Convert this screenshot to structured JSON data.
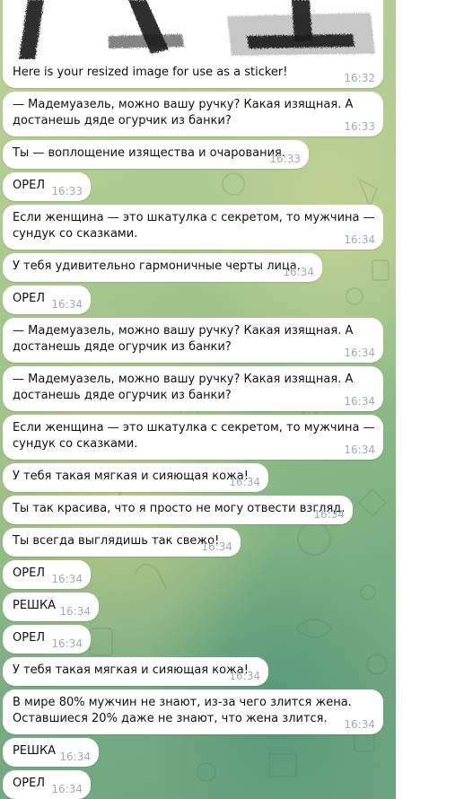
{
  "chat": {
    "sticker_caption": "Here is your resized image for use as a sticker!",
    "sticker_time": "16:32",
    "messages": [
      {
        "text": "— Мадемуазель, можно вашу ручку? Какая изящная. А\nдостанешь дяде огурчик из банки?",
        "time": "16:33"
      },
      {
        "text": "Ты — воплощение изящества и очарования.",
        "time": "16:33"
      },
      {
        "text": "ОРЕЛ",
        "time": "16:33"
      },
      {
        "text": "Если женщина — это шкатулка с секретом, то мужчина —\nсундук со сказками.",
        "time": "16:34"
      },
      {
        "text": "У тебя удивительно гармоничные черты лица.",
        "time": "16:34"
      },
      {
        "text": "ОРЕЛ",
        "time": "16:34"
      },
      {
        "text": "— Мадемуазель, можно вашу ручку? Какая изящная. А\nдостанешь дяде огурчик из банки?",
        "time": "16:34"
      },
      {
        "text": "— Мадемуазель, можно вашу ручку? Какая изящная. А\nдостанешь дяде огурчик из банки?",
        "time": "16:34"
      },
      {
        "text": "Если женщина — это шкатулка с секретом, то мужчина —\nсундук со сказками.",
        "time": "16:34"
      },
      {
        "text": "У тебя такая мягкая и сияющая кожа!",
        "time": "16:34"
      },
      {
        "text": "Ты так красива, что я просто не могу отвести взгляд.",
        "time": "16:34"
      },
      {
        "text": "Ты всегда выглядишь так свежо!",
        "time": "16:34"
      },
      {
        "text": "ОРЕЛ",
        "time": "16:34"
      },
      {
        "text": "РЕШКА",
        "time": "16:34"
      },
      {
        "text": "ОРЕЛ",
        "time": "16:34"
      },
      {
        "text": "У тебя такая мягкая и сияющая кожа!",
        "time": "16:34"
      },
      {
        "text": "В мире 80% мужчин не знают, из-за чего злится жена.\nОставшиеся 20% даже не знают, что жена злится.",
        "time": "16:34"
      },
      {
        "text": "РЕШКА",
        "time": "16:34"
      },
      {
        "text": "ОРЕЛ",
        "time": "16:34"
      }
    ]
  }
}
